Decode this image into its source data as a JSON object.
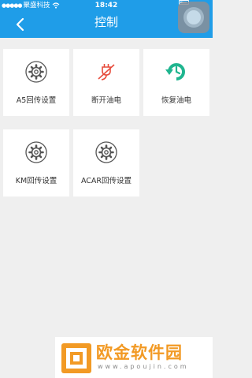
{
  "status_bar": {
    "carrier": "聚盛科技",
    "time": "18:42"
  },
  "header": {
    "title": "控制",
    "back_icon": "chevron-left-icon",
    "background": "#1f9de8"
  },
  "tiles": [
    {
      "label": "A5回传设置",
      "icon": "gear-icon"
    },
    {
      "label": "断开油电",
      "icon": "cut-power-icon",
      "icon_color": "#e74c3c"
    },
    {
      "label": "恢复油电",
      "icon": "restore-power-icon",
      "icon_color": "#1fb58f"
    },
    {
      "label": "KM回传设置",
      "icon": "gear-icon"
    },
    {
      "label": "ACAR回传设置",
      "icon": "gear-icon"
    }
  ],
  "watermark": {
    "title": "欧金软件园",
    "url": "www.apoujin.com",
    "color": "#f29a25"
  }
}
